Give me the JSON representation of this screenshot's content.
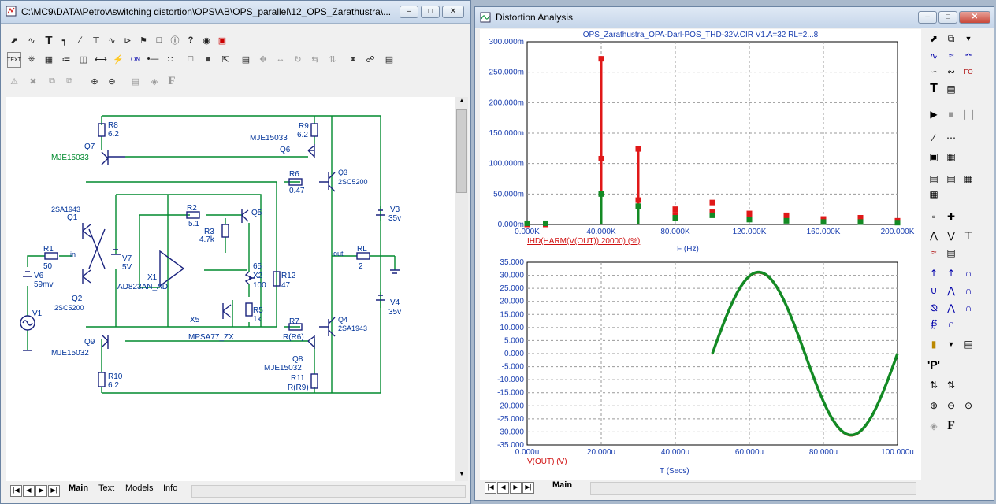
{
  "schematic_window": {
    "title": "C:\\MC9\\DATA\\Petrov\\switching distortion\\OPS\\AB\\OPS_parallel\\12_OPS_Zarathustra\\...",
    "tabs": [
      "Main",
      "Text",
      "Models",
      "Info"
    ],
    "components": {
      "R8": "R8",
      "R8v": "6.2",
      "R9": "R9",
      "R9v": "6.2",
      "Q7": "Q7",
      "Q7m": "MJE15033",
      "Q6": "Q6",
      "Q6m": "MJE15033",
      "R6": "R6",
      "R6v": "0.47",
      "Q3": "Q3",
      "Q3m": "2SC5200",
      "Q1m": "2SA1943",
      "Q1": "Q1",
      "R2": "R2",
      "R2v": "5.1",
      "Q5": "Q5",
      "R3": "R3",
      "R3v": "4.7k",
      "V3": "V3",
      "V3v": "35v",
      "R1": "R1",
      "R1v": "50",
      "in": "in",
      "V7": "V7",
      "V7v": "5V",
      "X2n": "65",
      "X2": "X2",
      "X2v": "100",
      "R12": "R12",
      "R12v": "47",
      "out": "out",
      "RL": "RL",
      "RLv": "2",
      "V6": "V6",
      "V6v": "59mv",
      "X1": "X1",
      "X1m": "AD823AN_AD",
      "R5": "R5",
      "R5v": "1k",
      "V4": "V4",
      "V4v": "35v",
      "V1": "V1",
      "Q2": "Q2",
      "Q2m": "2SC5200",
      "X5": "X5",
      "R7": "R7",
      "R7v": "R(R6)",
      "Q4": "Q4",
      "Q4m": "2SA1943",
      "Q9": "Q9",
      "Q9m": "MJE15032",
      "X5m": "MPSA77_ZX",
      "Q8": "Q8",
      "Q8m": "MJE15032",
      "R10": "R10",
      "R10v": "6.2",
      "R11": "R11",
      "R11v": "R(R9)"
    }
  },
  "analysis_window": {
    "title": "Distortion Analysis",
    "tabs": [
      "Main"
    ],
    "plot_title": "OPS_Zarathustra_OPA-Darl-POS_THD-32V.CIR V1.A=32 RL=2...8",
    "top_plot": {
      "y_ticks": [
        "300.000m",
        "250.000m",
        "200.000m",
        "150.000m",
        "100.000m",
        "50.000m",
        "0.000m"
      ],
      "x_ticks": [
        "0.000K",
        "40.000K",
        "80.000K",
        "120.000K",
        "160.000K",
        "200.000K"
      ],
      "trace_label": "IHD(HARM(V(OUT)),20000) (%)",
      "x_label": "F (Hz)"
    },
    "bottom_plot": {
      "y_ticks": [
        "35.000",
        "30.000",
        "25.000",
        "20.000",
        "15.000",
        "10.000",
        "5.000",
        "0.000",
        "-5.000",
        "-10.000",
        "-15.000",
        "-20.000",
        "-25.000",
        "-30.000",
        "-35.000"
      ],
      "x_ticks": [
        "0.000u",
        "20.000u",
        "40.000u",
        "60.000u",
        "80.000u",
        "100.000u"
      ],
      "trace_label": "V(OUT) (V)",
      "x_label": "T (Secs)"
    }
  },
  "chart_data": [
    {
      "type": "bar",
      "title": "OPS_Zarathustra_OPA-Darl-POS_THD-32V.CIR V1.A=32 RL=2...8",
      "xlabel": "F (Hz)",
      "ylabel": "IHD(HARM(V(OUT)),20000) (%)",
      "xlim": [
        0,
        200000
      ],
      "ylim": [
        0,
        0.3
      ],
      "x": [
        0,
        10000,
        40000,
        60000,
        80000,
        100000,
        120000,
        140000,
        160000,
        180000,
        200000
      ],
      "series": [
        {
          "color": "#e01818",
          "values": [
            0,
            0,
            0.272,
            0.124,
            0.025,
            0.036,
            0.018,
            0.015,
            0.009,
            0.011,
            0.006
          ]
        },
        {
          "color": "#e01818",
          "values": [
            0,
            0,
            0.108,
            0.04,
            0.016,
            0.02,
            0.011,
            0.008,
            0.006,
            0.006,
            0.004
          ]
        },
        {
          "color": "#138a24",
          "values": [
            0.002,
            0.002,
            0.05,
            0.03,
            0.011,
            0.015,
            0.008,
            0.006,
            0.004,
            0.004,
            0.003
          ]
        }
      ],
      "grid": true
    },
    {
      "type": "line",
      "xlabel": "T (Secs)",
      "ylabel": "V(OUT) (V)",
      "xlim": [
        0,
        100
      ],
      "x_unit": "u",
      "ylim": [
        -35,
        35
      ],
      "series": [
        {
          "color": "#138a24",
          "t_start": 50,
          "t_end": 100,
          "amplitude": 31.2,
          "period": 50
        }
      ],
      "grid": true
    }
  ]
}
